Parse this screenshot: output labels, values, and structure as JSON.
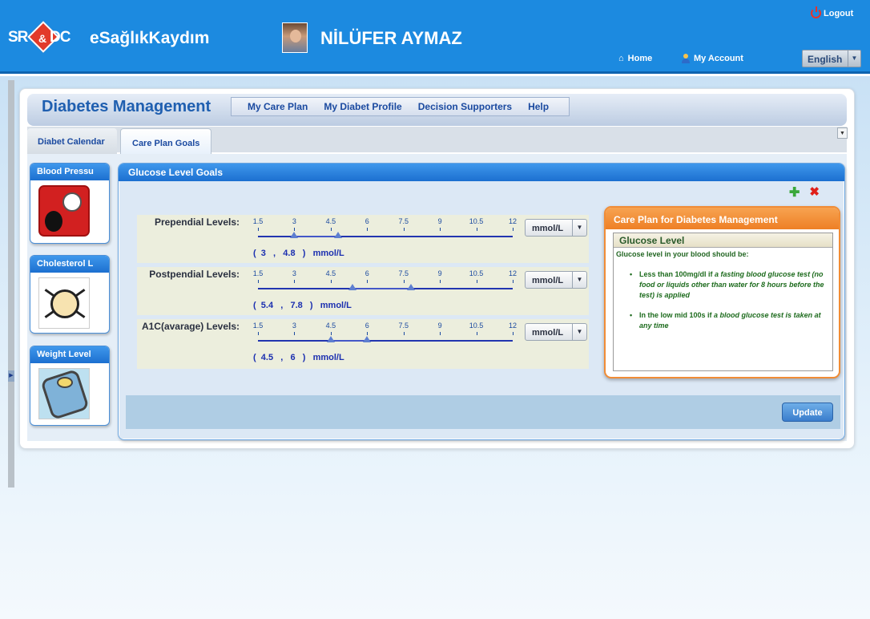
{
  "header": {
    "logo_sr": "SR",
    "logo_amp": "&",
    "logo_dc": "DC",
    "brand": "eSağlıkKaydım",
    "user_name": "NİLÜFER AYMAZ",
    "logout": "Logout",
    "home": "Home",
    "account": "My Account",
    "language": "English"
  },
  "app": {
    "title": "Diabetes Management",
    "menu": [
      "My Care Plan",
      "My Diabet Profile",
      "Decision Supporters",
      "Help"
    ],
    "tabs": [
      "Diabet Calendar",
      "Care Plan Goals"
    ],
    "active_tab": "Care Plan Goals"
  },
  "widgets": [
    {
      "title": "Blood Pressu",
      "icon": "blood-pressure-icon"
    },
    {
      "title": "Cholesterol L",
      "icon": "cholesterol-icon"
    },
    {
      "title": "Weight Level",
      "icon": "weight-scale-icon"
    }
  ],
  "goals_panel": {
    "title": "Glucose Level Goals",
    "scale_ticks": [
      "1.5",
      "3",
      "4.5",
      "6",
      "7.5",
      "9",
      "10.5",
      "12"
    ],
    "scale_min": 1.5,
    "scale_max": 12,
    "rows": [
      {
        "label": "Prependial Levels:",
        "low": 3,
        "high": 4.8,
        "display": "(  3   ,   4.8   )   mmol/L",
        "unit": "mmol/L"
      },
      {
        "label": "Postpendial Levels:",
        "low": 5.4,
        "high": 7.8,
        "display": "(  5.4   ,   7.8   )   mmol/L",
        "unit": "mmol/L"
      },
      {
        "label": "A1C(avarage) Levels:",
        "low": 4.5,
        "high": 6,
        "display": "(  4.5   ,   6   )   mmol/L",
        "unit": "mmol/L"
      }
    ],
    "update_label": "Update"
  },
  "care_plan": {
    "title": "Care Plan for Diabetes Management",
    "section": "Glucose Level",
    "intro": "Glucose level in your blood should be:",
    "item1_prefix": "Less than 100mg/dl if",
    "item1_em": "a fasting blood glucose test (no food or liquids other than water for 8 hours before the test) is applied",
    "item2_prefix": "In the low mid 100s if",
    "item2_em": "a blood glucose test is taken at any time"
  },
  "colors": {
    "topbar": "#1c8ae0",
    "widget_header": "#1c6fd0",
    "care_header": "#ee7f25",
    "care_text": "#1d6b1d"
  }
}
